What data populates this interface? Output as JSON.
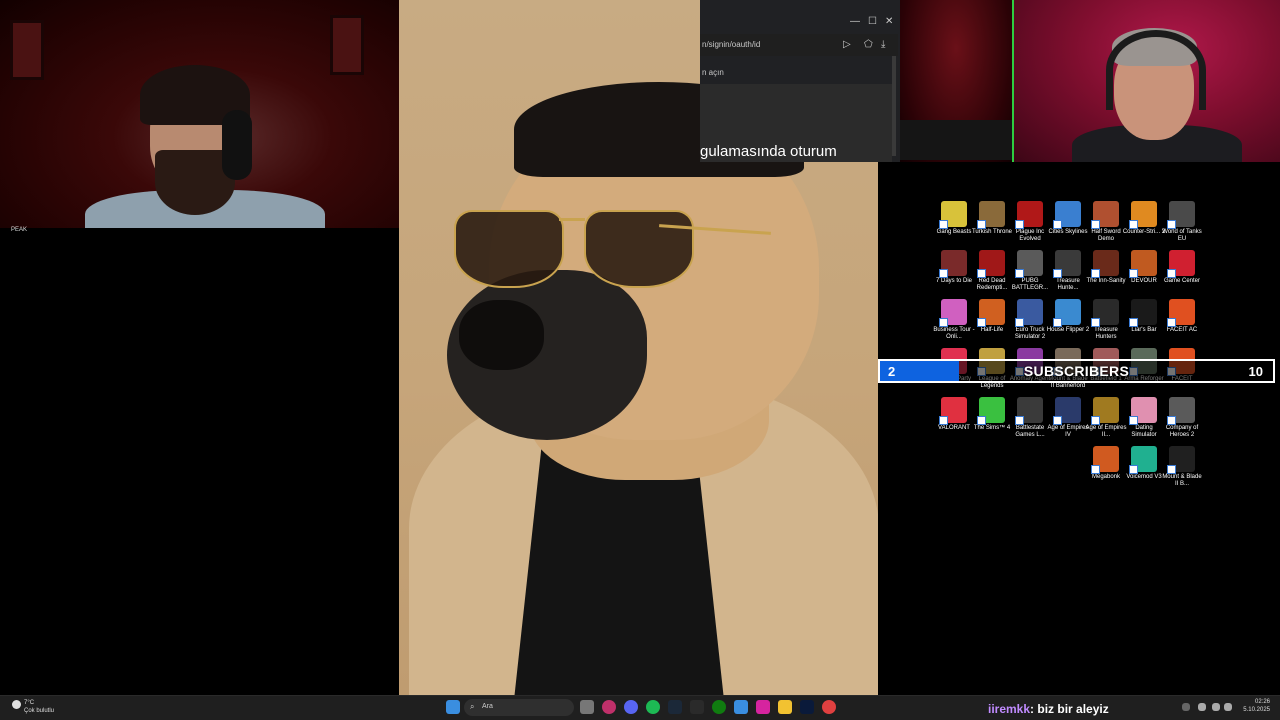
{
  "webcam_left": {
    "label": "PEAK"
  },
  "browser": {
    "url_text": "n/signin/oauth/id",
    "sub_text": "n açın",
    "big_text": "gulamasında oturum",
    "minimize": "—",
    "maximize": "☐",
    "close": "✕"
  },
  "desktop": {
    "icons": [
      {
        "label": "Gang Beasts",
        "color": "#d8c23a"
      },
      {
        "label": "Turkish Throne",
        "color": "#8a6a3a"
      },
      {
        "label": "Plague Inc Evolved",
        "color": "#b01818"
      },
      {
        "label": "Cities Skylines",
        "color": "#3a7fd0"
      },
      {
        "label": "Half Sword Demo",
        "color": "#b05030"
      },
      {
        "label": "Counter-Stri... 2",
        "color": "#e08a20"
      },
      {
        "label": "World of Tanks EU",
        "color": "#4a4a4a"
      },
      {
        "label": "7 Days to Die",
        "color": "#7a2a2a"
      },
      {
        "label": "Red Dead Redempti...",
        "color": "#a01818"
      },
      {
        "label": "PUBG BATTLEGR...",
        "color": "#5a5a5a"
      },
      {
        "label": "Treasure Hunte...",
        "color": "#3a3a3a"
      },
      {
        "label": "The Inn-Sanity",
        "color": "#6a2a1a"
      },
      {
        "label": "DEVOUR",
        "color": "#c05a20"
      },
      {
        "label": "Game Center",
        "color": "#d02030"
      },
      {
        "label": "Business Tour - Onli...",
        "color": "#d060c0"
      },
      {
        "label": "Half-Life",
        "color": "#d06020"
      },
      {
        "label": "Euro Truck Simulator 2",
        "color": "#3a5aa0"
      },
      {
        "label": "House Flipper 2",
        "color": "#3a8ad0"
      },
      {
        "label": "Treasure Hunters",
        "color": "#2a2a2a"
      },
      {
        "label": "Liar's Bar",
        "color": "#1a1a1a"
      },
      {
        "label": "FACEIT AC",
        "color": "#e05020"
      },
      {
        "label": "Animal Party",
        "color": "#e03050"
      },
      {
        "label": "League of Legends",
        "color": "#c0a040"
      },
      {
        "label": "Anomaly Agent",
        "color": "#8a3aa0"
      },
      {
        "label": "Mount & Blade II Bannerlord",
        "color": "#7a6a5a"
      },
      {
        "label": "Battlefield 1",
        "color": "#a05a5a"
      },
      {
        "label": "Arma Reforger",
        "color": "#5a6a5a"
      },
      {
        "label": "FACEIT",
        "color": "#e05020"
      },
      {
        "label": "VALORANT",
        "color": "#e03040"
      },
      {
        "label": "The Sims™ 4",
        "color": "#3ac040"
      },
      {
        "label": "Battlestate Games L...",
        "color": "#3a3a3a"
      },
      {
        "label": "Age of Empires IV",
        "color": "#2a3a6a"
      },
      {
        "label": "Age of Empires II...",
        "color": "#a07a20"
      },
      {
        "label": "Dating Simulator",
        "color": "#e090b0"
      },
      {
        "label": "Company of Heroes 2",
        "color": "#5a5a5a"
      },
      {
        "label": "Megabonk",
        "color": "#d05a20"
      },
      {
        "label": "Voicemod V3",
        "color": "#20b090"
      },
      {
        "label": "Mount & Blade II B...",
        "color": "#202020"
      }
    ]
  },
  "subscribers": {
    "current": "2",
    "label": "SUBSCRIBERS",
    "goal": "10",
    "progress": 0.2
  },
  "taskbar": {
    "weather_temp": "7°C",
    "weather_desc": "Çok bulutlu",
    "search_placeholder": "Ara",
    "chat_user": "iiremkk",
    "chat_message": ": biz bir aleyiz",
    "time": "02:26",
    "date": "5.10.2025"
  }
}
